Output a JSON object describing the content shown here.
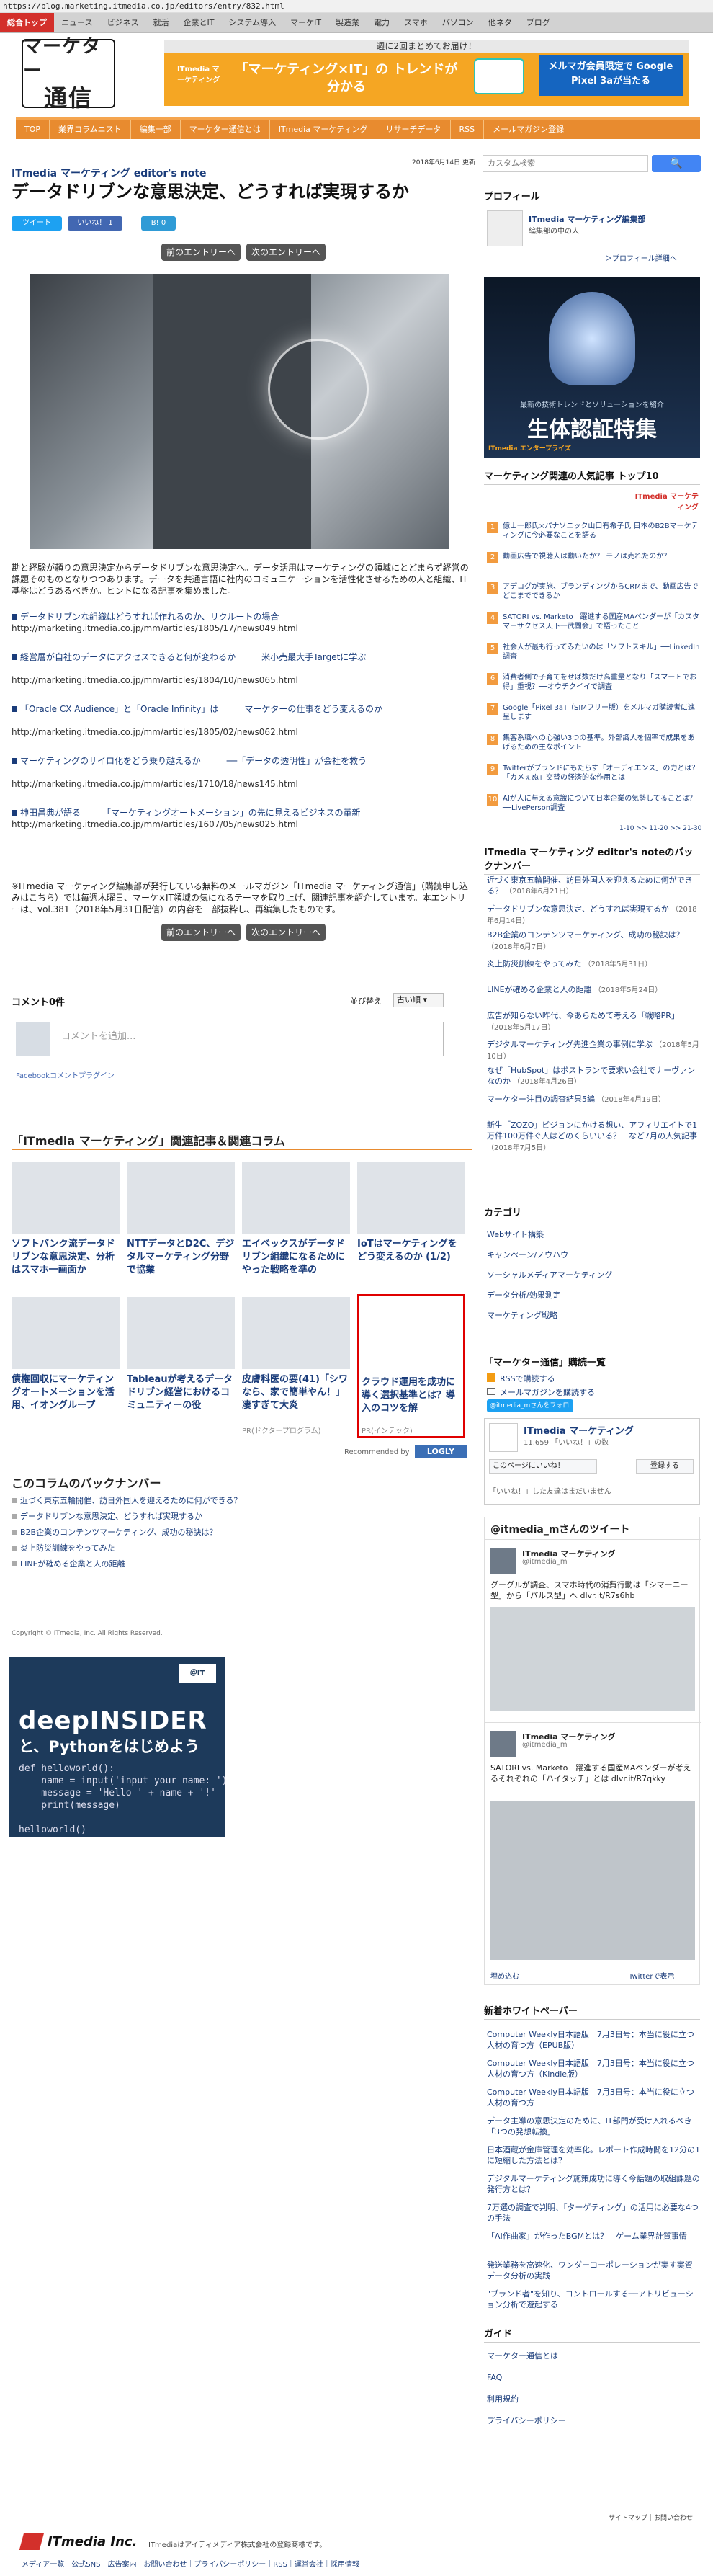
{
  "browser": {
    "url": "https://blog.marketing.itmedia.co.jp/editors/entry/832.html"
  },
  "topnav": [
    "総合トップ",
    "ニュース",
    "ビジネス",
    "就活",
    "企業とIT",
    "システム導入",
    "マーケIT",
    "製造業",
    "電力",
    "スマホ",
    "パソコン",
    "他ネタ",
    "ブログ"
  ],
  "logo": {
    "line1": "マーケター",
    "line2": "通信"
  },
  "top_banner": {
    "header": "週に2回まとめてお届け！",
    "left": "ITmedia マーケティング",
    "main": "「マーケティング×IT」の トレンドが分かる",
    "right": "メルマガ会員限定で Google Pixel 3aが当たる"
  },
  "mainnav": [
    "TOP",
    "業界コラムニスト",
    "編集一部",
    "マーケター通信とは",
    "ITmedia マーケティング",
    "リサーチデータ",
    "RSS",
    "メールマガジン登録"
  ],
  "date": "2018年6月14日 更新",
  "search": {
    "placeholder": "カスタム検索",
    "button": "🔍"
  },
  "article": {
    "column": "ITmedia マーケティング editor's note",
    "title": "データドリブンな意思決定、どうすれば実現するか",
    "social": {
      "tweet": "ツイート",
      "like": "いいね！ 1",
      "bookmark": "B! 0"
    },
    "prev": "前のエントリーへ",
    "next": "次のエントリーへ",
    "intro": "勘と経験が頼りの意思決定からデータドリブンな意思決定へ。データ活用はマーケティングの領域にとどまらず経営の課題そのものとなりつつあります。データを共通言語に社内のコミュニケーションを活性化させるための人と組織、IT基盤はどうあるべきか。ヒントになる記事を集めました。",
    "links": [
      {
        "title": "データドリブンな組織はどうすれば作れるのか、リクルートの場合",
        "url": "http://marketing.itmedia.co.jp/mm/articles/1805/17/news049.html"
      },
      {
        "title": "経営層が自社のデータにアクセスできると何が変わるか　　　米小売最大手Targetに学ぶ",
        "url": "http://marketing.itmedia.co.jp/mm/articles/1804/10/news065.html"
      },
      {
        "title": "「Oracle CX Audience」と「Oracle Infinity」は　　　マーケターの仕事をどう変えるのか",
        "url": "http://marketing.itmedia.co.jp/mm/articles/1805/02/news062.html"
      },
      {
        "title": "マーケティングのサイロ化をどう乗り越えるか　　　──「データの透明性」が会社を救う",
        "url": "http://marketing.itmedia.co.jp/mm/articles/1710/18/news145.html"
      },
      {
        "title": "神田昌典が語る　　　「マーケティングオートメーション」の先に見えるビジネスの革新",
        "url": "http://marketing.itmedia.co.jp/mm/articles/1607/05/news025.html"
      }
    ],
    "footnote": "※ITmedia マーケティング編集部が発行している無料のメールマガジン「ITmedia マーケティング通信」（購読申し込みはこちら）では毎週木曜日、マーケ×IT領域の気になるテーマを取り上げ、関連記事を紹介しています。本エントリーは、vol.381（2018年5月31日配信）の内容を一部抜粋し、再編集したものです。"
  },
  "comments": {
    "count": "コメント0件",
    "sort_label": "並び替え",
    "sort_value": "古い順 ▾",
    "placeholder": "コメントを追加...",
    "plugin": "Facebookコメントプラグイン"
  },
  "related": {
    "title": "「ITmedia マーケティング」関連記事＆関連コラム",
    "row1": [
      "ソフトバンク流データドリブンな意思決定、分析はスマホ一画面か",
      "NTTデータとD2C、デジタルマーケティング分野で協業",
      "エイベックスがデータドリブン組織になるためにやった戦略を準の",
      "IoTはマーケティングをどう変えるのか (1/2)"
    ],
    "row2": [
      "債権回収にマーケティングオートメーションを活用、イオングループ",
      "Tableauが考えるデータドリブン経営におけるコミュニティーの役",
      "皮膚科医の要(41)「シワなら、家で簡単やん！」凄すぎて大炎",
      "クラウド運用を成功に導く選択基準とは？導入のコツを解"
    ],
    "pr": "PR(ドクタープログラム)",
    "pr2": "PR(インテック)",
    "recommended": "Recommended by",
    "logly": "LOGLY"
  },
  "backnumber": {
    "title": "このコラムのバックナンバー",
    "items": [
      "近づく東京五輪開催、訪日外国人を迎えるために何ができる？",
      "データドリブンな意思決定、どうすれば実現するか",
      "B2B企業のコンテンツマーケティング、成功の秘訣は？",
      "炎上防災訓練をやってみた",
      "LINEが確める企業と人の距離"
    ]
  },
  "copyright": "Copyright © ITmedia, Inc. All Rights Reserved.",
  "ad_deep": {
    "badge": "＠IT",
    "brand": "deepINSIDER",
    "line2": "と、Pythonをはじめよう",
    "code": "def helloworld():\n    name = input('input your name: ')\n    message = 'Hello ' + name + '!'\n    print(message)\n\nhelloworld()"
  },
  "sidebar": {
    "profile": {
      "title": "プロフィール",
      "name": "ITmedia マーケティング編集部",
      "role": "編集部の中の人",
      "more": "＞プロフィール詳細へ"
    },
    "ad": {
      "line1": "最新の技術トレンドとソリューションを紹介",
      "main": "生体認証特集",
      "brand": "ITmedia エンタープライズ"
    },
    "ranking": {
      "title": "マーケティング関連の人気記事 トップ10",
      "items": [
        "億山一郎氏×パナソニック山口有希子氏 日本のB2Bマーケティングに今必要なことを語る",
        "動画広告で視聴人は動いたか？ モノは売れたのか？",
        "アデコグが実施、ブランディングからCRMまで、動画広告でどこまでできるか",
        "SATORI vs. Marketo　躍進する国産MAベンダーが「カスタマーサクセス天下一武闘会」で語ったこと",
        "社会人が最も行ってみたいのは「ソフトスキル」──LinkedIn調査",
        "消費者側で子育てをせば数だけ高重量となり「スマートでお得」重視？──オウチクイイで調査",
        "Google「Pixel 3a」（SIMフリー版）をメルマガ購読者に進呈します",
        "集客系職への心強い3つの基準。外部識人を個率で成果をあげるための主なポイント",
        "Twitterがブランドにもたらす「オーディエンス」の力とは？　「カメぇぬ」交替の経済的な作用とは",
        "AIが人に与える意識について日本企業の気勢してることは？──LivePerson調査"
      ],
      "more": "1-10 >> 11-20 >> 21-30"
    },
    "editors": {
      "title": "ITmedia マーケティング editor's noteのバックナンバー",
      "items": [
        {
          "t": "近づく東京五輪開催、訪日外国人を迎えるために何ができる？",
          "d": "（2018年6月21日）"
        },
        {
          "t": "データドリブンな意思決定、どうすれば実現するか",
          "d": "（2018年6月14日）"
        },
        {
          "t": "B2B企業のコンテンツマーケティング、成功の秘訣は？",
          "d": "（2018年6月7日）"
        },
        {
          "t": "炎上防災訓練をやってみた",
          "d": "（2018年5月31日）"
        },
        {
          "t": "LINEが確める企業と人の距離",
          "d": "（2018年5月24日）"
        },
        {
          "t": "広告が知らない昨代、今あらためて考える「戦略PR」",
          "d": "（2018年5月17日）"
        },
        {
          "t": "デジタルマーケティング先進企業の事例に学ぶ",
          "d": "（2018年5月10日）"
        },
        {
          "t": "なぜ「HubSpot」はポストランで要求い会社でナーヴァンなのか",
          "d": "（2018年4月26日）"
        },
        {
          "t": "マーケター注目の調査結果5編",
          "d": "（2018年4月19日）"
        },
        {
          "t": "新生「ZOZO」ビジョンにかける想い、アフィリエイトで1万件100万件ぐ人はどのくらいいる？　など7月の人気記事",
          "d": "（2018年7月5日）"
        }
      ]
    },
    "category": {
      "title": "カテゴリ",
      "items": [
        "Webサイト構築",
        "キャンペーン/ノウハウ",
        "ソーシャルメディアマーケティング",
        "データ分析/効果測定",
        "マーケティング戦略"
      ]
    },
    "subscribe": {
      "title": "「マーケター通信」購読一覧",
      "rss": "RSSで購読する",
      "mail": "メールマガジンを購読する",
      "twitter": "@itmedia_mさんをフォロー"
    },
    "fb": {
      "name": "ITmedia マーケティング",
      "likes": "11,659 「いいね！」の数",
      "share": "このページにいいね！",
      "register": "登録する",
      "friends": "「いいね！」した友達はまだいません"
    },
    "tw": {
      "title": "@itmedia_mさんのツイート",
      "t1": {
        "name": "ITmedia マーケティング",
        "handle": "@itmedia_m",
        "text": "グーグルが調査、スマホ時代の消費行動は「シマーニー型」から「パルス型」へ dlvr.it/R7s6hb"
      },
      "t2": {
        "name": "ITmedia マーケティング",
        "handle": "@itmedia_m",
        "text": "SATORI vs. Marketo　躍進する国産MAベンダーが考えるそれぞれの「ハイタッチ」とは dlvr.it/R7qkky"
      },
      "embed": "埋め込む",
      "view": "Twitterで表示"
    },
    "whitepaper": {
      "title": "新着ホワイトペーパー",
      "items": [
        "Computer Weekly日本語版　7月3日号：本当に役に立つ人材の育つ方（EPUB版）",
        "Computer Weekly日本語版　7月3日号：本当に役に立つ人材の育つ方（Kindle版）",
        "Computer Weekly日本語版　7月3日号：本当に役に立つ人材の育つ方",
        "データ主導の意思決定のために、IT部門が受け入れるべき「3つの発想転換」",
        "日本酒蔵が金庫管理を効率化。レポート作成時間を12分の1に短縮した方法とは？",
        "デジタルマーケティング施策成功に導く今話題の取組課題の発行方とは？",
        "7万選の調査で判明、「ターゲティング」の活用に必要な4つの手法",
        "「AI作曲家」が作ったBGMとは？　ゲーム業界計質事情",
        "発送業務を高速化、ワンダーコーポレーションが実す実資データ分析の実践",
        "\"ブランド者\"を知り、コントロールする──アトリビューション分析で遊起する"
      ]
    },
    "guide": {
      "title": "ガイド",
      "items": [
        "マーケター通信とは",
        "FAQ",
        "利用規約",
        "プライバシーポリシー"
      ]
    }
  },
  "footer": {
    "top_links": "サイトマップ｜お問い合わせ",
    "logo": "ITmedia Inc.",
    "notice": "ITmediaはアイティメディア株式会社の登録商標です。",
    "links": "メディア一覧｜公式SNS｜広告案内｜お問い合わせ｜プライバシーポリシー｜RSS｜運営会社｜採用情報"
  },
  "colors": {
    "accent_orange": "#e88b2f",
    "nav_red": "#d3302b",
    "link_blue": "#1a3c7a",
    "pr_red": "#e00000"
  }
}
